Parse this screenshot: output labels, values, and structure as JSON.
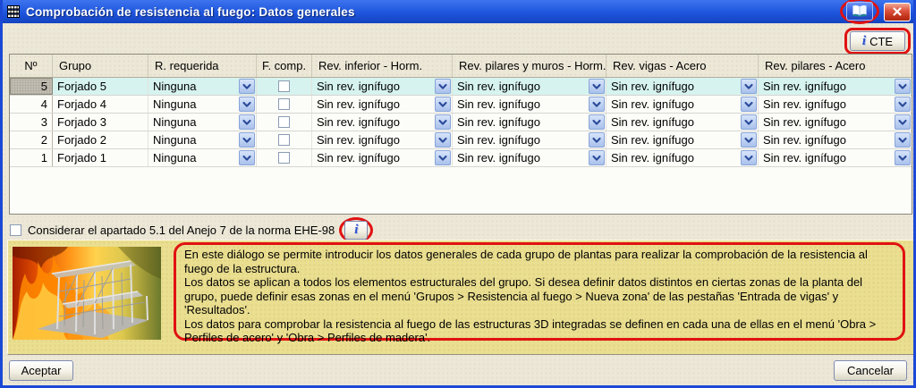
{
  "window": {
    "title": "Comprobación de resistencia al fuego: Datos generales",
    "icons": {
      "app_icon": "stacked-floors-icon",
      "help_book_icon": "open-book-icon",
      "close_icon": "close-x-icon",
      "info_icon": "info-i-icon"
    }
  },
  "cte_button": {
    "label": "CTE"
  },
  "table": {
    "headers": [
      "Nº",
      "Grupo",
      "R. requerida",
      "F. comp.",
      "Rev. inferior - Horm.",
      "Rev. pilares y muros - Horm.",
      "Rev. vigas - Acero",
      "Rev. pilares - Acero"
    ],
    "rows": [
      {
        "num": "5",
        "grupo": "Forjado 5",
        "r_requerida": "Ninguna",
        "f_comp": false,
        "rev_inferior": "Sin rev. ignífugo",
        "rev_pilares_muros": "Sin rev. ignífugo",
        "rev_vigas": "Sin rev. ignífugo",
        "rev_pilares": "Sin rev. ignífugo",
        "selected": true
      },
      {
        "num": "4",
        "grupo": "Forjado 4",
        "r_requerida": "Ninguna",
        "f_comp": false,
        "rev_inferior": "Sin rev. ignífugo",
        "rev_pilares_muros": "Sin rev. ignífugo",
        "rev_vigas": "Sin rev. ignífugo",
        "rev_pilares": "Sin rev. ignífugo",
        "selected": false
      },
      {
        "num": "3",
        "grupo": "Forjado 3",
        "r_requerida": "Ninguna",
        "f_comp": false,
        "rev_inferior": "Sin rev. ignífugo",
        "rev_pilares_muros": "Sin rev. ignífugo",
        "rev_vigas": "Sin rev. ignífugo",
        "rev_pilares": "Sin rev. ignífugo",
        "selected": false
      },
      {
        "num": "2",
        "grupo": "Forjado 2",
        "r_requerida": "Ninguna",
        "f_comp": false,
        "rev_inferior": "Sin rev. ignífugo",
        "rev_pilares_muros": "Sin rev. ignífugo",
        "rev_vigas": "Sin rev. ignífugo",
        "rev_pilares": "Sin rev. ignífugo",
        "selected": false
      },
      {
        "num": "1",
        "grupo": "Forjado 1",
        "r_requerida": "Ninguna",
        "f_comp": false,
        "rev_inferior": "Sin rev. ignífugo",
        "rev_pilares_muros": "Sin rev. ignífugo",
        "rev_vigas": "Sin rev. ignífugo",
        "rev_pilares": "Sin rev. ignífugo",
        "selected": false
      }
    ]
  },
  "ehe_checkbox": {
    "label": "Considerar el apartado 5.1 del Anejo 7 de la norma EHE-98",
    "checked": false
  },
  "info_panel": {
    "paragraphs": [
      "En este diálogo se permite introducir los datos generales de cada grupo de plantas para realizar la comprobación de la resistencia al fuego de la estructura.",
      "Los datos se aplican a todos los elementos estructurales del grupo. Si desea definir datos distintos en ciertas zonas de la planta del grupo, puede definir esas zonas en el menú 'Grupos > Resistencia al fuego > Nueva zona' de las pestañas 'Entrada de vigas' y 'Resultados'.",
      "Los datos para comprobar la resistencia al fuego de las estructuras 3D integradas se definen en cada una de ellas en el menú 'Obra > Perfiles de acero' y 'Obra > Perfiles de madera'."
    ]
  },
  "buttons": {
    "accept": "Aceptar",
    "cancel": "Cancelar"
  },
  "colors": {
    "titlebar_blue": "#1e55dd",
    "annotation_red": "#e01212",
    "selected_row_cyan": "#d6f3ef",
    "panel_yellow": "#eadf90",
    "window_border_blue": "#1b49d6"
  }
}
